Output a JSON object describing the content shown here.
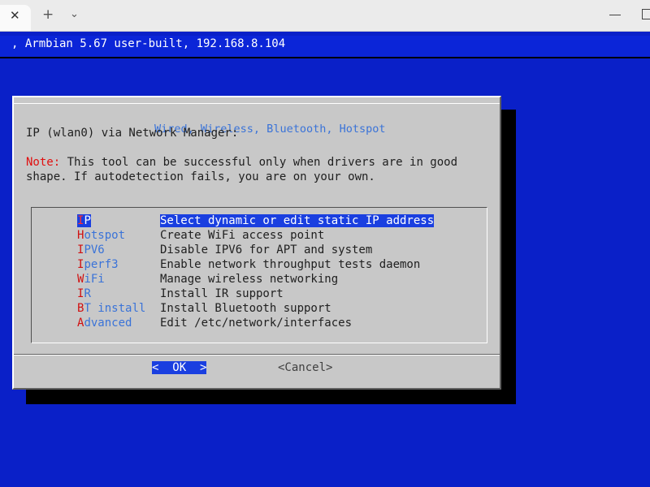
{
  "window": {
    "close_glyph": "✕",
    "new_tab_glyph": "+",
    "dropdown_glyph": "⌄"
  },
  "statusline": {
    "text": ", Armbian 5.67 user-built, 192.168.8.104"
  },
  "dialog": {
    "title": "Wired, Wireless, Bluetooth, Hotspot",
    "line1": "IP (wlan0) via Network Manager:",
    "note_label": "Note:",
    "note_text": " This tool can be successful only when drivers are in good",
    "note_line2": "shape. If autodetection fails, you are on your own."
  },
  "menu": {
    "items": [
      {
        "hotkey": "I",
        "rest": "P",
        "desc": "Select dynamic or edit static IP address",
        "selected": true
      },
      {
        "hotkey": "H",
        "rest": "otspot",
        "desc": "Create WiFi access point",
        "selected": false
      },
      {
        "hotkey": "I",
        "rest": "PV6",
        "desc": "Disable IPV6 for APT and system",
        "selected": false
      },
      {
        "hotkey": "I",
        "rest": "perf3",
        "desc": "Enable network throughput tests daemon",
        "selected": false
      },
      {
        "hotkey": "W",
        "rest": "iFi",
        "desc": "Manage wireless networking",
        "selected": false
      },
      {
        "hotkey": "I",
        "rest": "R",
        "desc": "Install IR support",
        "selected": false
      },
      {
        "hotkey": "B",
        "rest": "T install",
        "desc": "Install Bluetooth support",
        "selected": false
      },
      {
        "hotkey": "A",
        "rest": "dvanced",
        "desc": "Edit /etc/network/interfaces",
        "selected": false
      }
    ]
  },
  "buttons": {
    "ok_left": "<",
    "ok_label": "OK",
    "ok_right": ">",
    "cancel": "<Cancel>"
  },
  "colors": {
    "desktop": "#0a20c8",
    "dialog": "#c8c8c8",
    "highlight": "#1a3fe0",
    "tag": "#3a73d8",
    "hotkey": "#d01010"
  }
}
